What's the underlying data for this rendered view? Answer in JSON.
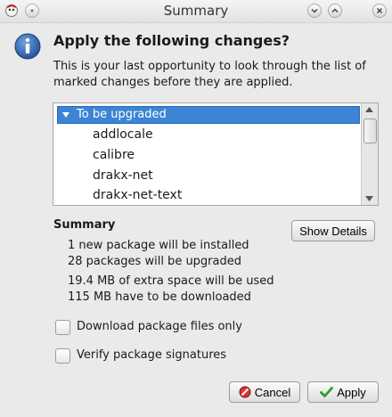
{
  "window": {
    "title": "Summary"
  },
  "header": {
    "heading": "Apply the following changes?",
    "description": "This is your last opportunity to look through the list of marked changes before they are applied."
  },
  "tree": {
    "group_label": "To be upgraded",
    "items": [
      "addlocale",
      "calibre",
      "drakx-net",
      "drakx-net-text"
    ]
  },
  "summary": {
    "title": "Summary",
    "show_details_label": "Show Details",
    "lines": [
      "1 new package will be installed",
      "28 packages will be upgraded",
      "19.4 MB of extra space will be used",
      "115 MB have to be downloaded"
    ]
  },
  "options": {
    "download_only": "Download package files only",
    "verify_signatures": "Verify package signatures"
  },
  "buttons": {
    "cancel": "Cancel",
    "apply": "Apply"
  },
  "colors": {
    "selection": "#3b85d4",
    "info_icon": "#2a5fa8",
    "apply_check": "#2e9a2e",
    "cancel_icon": "#c22"
  }
}
